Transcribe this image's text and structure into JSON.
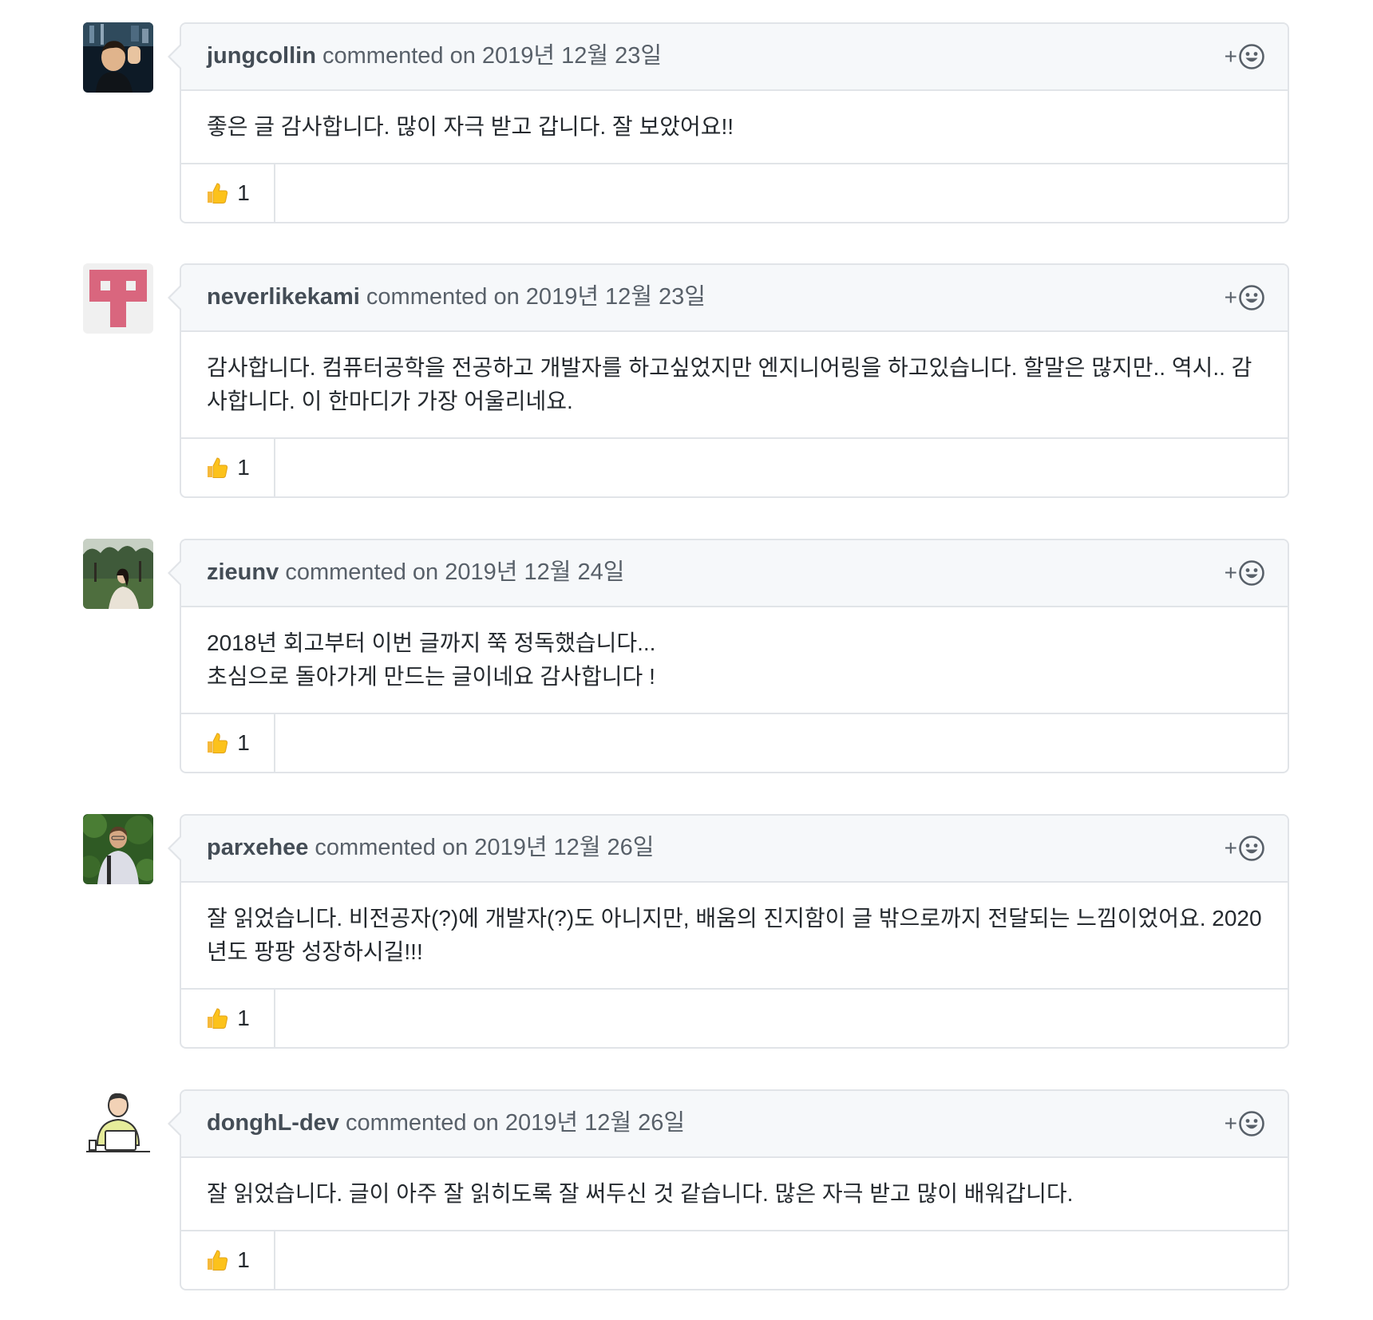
{
  "comments": [
    {
      "author": "jungcollin",
      "meta": "commented on 2019년 12월 23일",
      "avatar": "photo-avatar-dark",
      "body": "좋은 글 감사합니다. 많이 자극 받고 갑니다. 잘 보았어요!!",
      "reaction": {
        "emoji": "thumbs-up-icon",
        "count": "1"
      }
    },
    {
      "author": "neverlikekami",
      "meta": "commented on 2019년 12월 23일",
      "avatar": "identicon-pink",
      "body": "감사합니다. 컴퓨터공학을 전공하고 개발자를 하고싶었지만 엔지니어링을 하고있습니다. 할말은 많지만.. 역시.. 감사합니다. 이 한마디가 가장 어울리네요.",
      "reaction": {
        "emoji": "thumbs-up-icon",
        "count": "1"
      }
    },
    {
      "author": "zieunv",
      "meta": "commented on 2019년 12월 24일",
      "avatar": "photo-avatar-park",
      "body": "2018년 회고부터 이번 글까지 쭉 정독했습니다...\n초심으로 돌아가게 만드는 글이네요 감사합니다 !",
      "reaction": {
        "emoji": "thumbs-up-icon",
        "count": "1"
      }
    },
    {
      "author": "parxehee",
      "meta": "commented on 2019년 12월 26일",
      "avatar": "photo-avatar-green",
      "body": "잘 읽었습니다. 비전공자(?)에 개발자(?)도 아니지만, 배움의 진지함이 글 밖으로까지 전달되는 느낌이었어요. 2020년도 팡팡 성장하시길!!!",
      "reaction": {
        "emoji": "thumbs-up-icon",
        "count": "1"
      }
    },
    {
      "author": "donghL-dev",
      "meta": "commented on 2019년 12월 26일",
      "avatar": "illustration-avatar-laptop",
      "body": "잘 읽었습니다. 글이 아주 잘 읽히도록 잘 써두신 것 같습니다. 많은 자극 받고 많이 배워갑니다.",
      "reaction": {
        "emoji": "thumbs-up-icon",
        "count": "1"
      }
    }
  ],
  "reaction_button": {
    "plus": "+",
    "icon": "smiley-icon"
  },
  "colors": {
    "border": "#e1e4e8",
    "header_bg": "#f6f8fa",
    "meta_text": "#586069",
    "body_text": "#24292e",
    "identicon": "#d9667e"
  }
}
